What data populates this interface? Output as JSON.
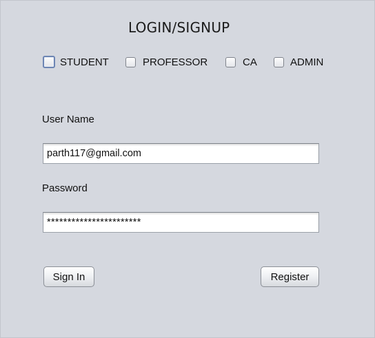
{
  "title": "LOGIN/SIGNUP",
  "roles": [
    {
      "label": "STUDENT",
      "checked": false,
      "focused": true
    },
    {
      "label": "PROFESSOR",
      "checked": false,
      "focused": false
    },
    {
      "label": "CA",
      "checked": false,
      "focused": false
    },
    {
      "label": "ADMIN",
      "checked": false,
      "focused": false
    }
  ],
  "username": {
    "label": "User Name",
    "value": "parth117@gmail.com"
  },
  "password": {
    "label": "Password",
    "value": "***********************"
  },
  "buttons": {
    "sign_in": "Sign In",
    "register": "Register"
  },
  "colors": {
    "background": "#d5d8df",
    "focus_border": "#6d85b3"
  }
}
